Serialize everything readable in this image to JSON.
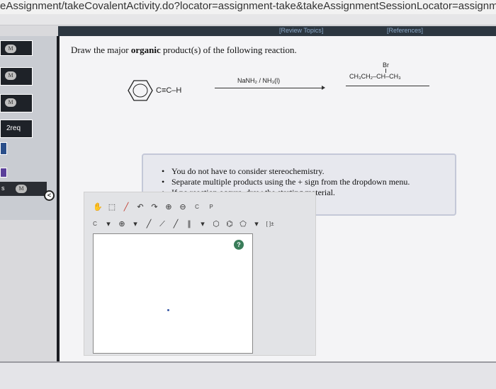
{
  "browser": {
    "url_text": "eAssignment/takeCovalentActivity.do?locator=assignment-take&takeAssignmentSessionLocator=assignmer"
  },
  "header": {
    "review_topics": "[Review Topics]",
    "references": "[References]"
  },
  "sidebar": {
    "badge": "M",
    "item_2req": "2req",
    "item_s": "s",
    "collapse_icon": "<"
  },
  "question": {
    "prefix": "Draw the major ",
    "bold": "organic",
    "suffix": " product(s) of the following reaction."
  },
  "reaction": {
    "reactant_chain": "C≡C–H",
    "reagent": "NaNH₂ / NH₃(l)",
    "second_reagent": "CH₃CH₂–CH–CH₃",
    "br": "Br"
  },
  "instructions": [
    "You do not have to consider stereochemistry.",
    "Separate multiple products using the + sign from the dropdown menu.",
    "If no reaction occurs, draw the starting material."
  ],
  "toolbar": {
    "c_label": "C",
    "p_label": "P",
    "atom_label": "C",
    "bracket_label": "[ ]±",
    "help_label": "?"
  }
}
